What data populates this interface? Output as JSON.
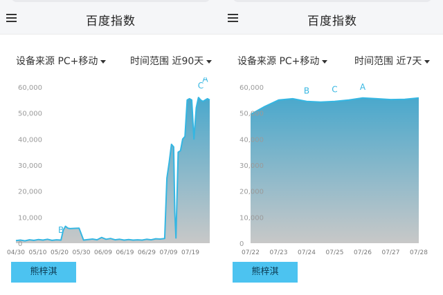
{
  "panels": [
    {
      "title": "百度指数",
      "device_filter": "设备来源 PC+移动",
      "range_filter": "时间范围 近90天",
      "button_label": "熊梓淇",
      "chart_data": {
        "type": "area",
        "title": "",
        "x_tick_labels": [
          "04/30",
          "05/10",
          "05/20",
          "05/30",
          "06/09",
          "06/19",
          "06/29",
          "07/09",
          "07/19"
        ],
        "y_tick_labels": [
          "0",
          "10,000",
          "20,000",
          "30,000",
          "40,000",
          "50,000",
          "60,000"
        ],
        "ylim": [
          0,
          60000
        ],
        "xlim": [
          0,
          86
        ],
        "grid": false,
        "colors": {
          "line": "#35b6e2",
          "fill_top": "#4aa8cc",
          "fill_bottom": "#c8c8c8"
        },
        "x": [
          0,
          2,
          4,
          6,
          8,
          10,
          12,
          14,
          16,
          18,
          20,
          21,
          22,
          23,
          24,
          26,
          28,
          30,
          32,
          34,
          36,
          38,
          40,
          42,
          44,
          46,
          48,
          50,
          52,
          54,
          56,
          58,
          60,
          62,
          64,
          66,
          67,
          68,
          69,
          70,
          70.5,
          71,
          72,
          73,
          74,
          75,
          76,
          77,
          78,
          79,
          80,
          81,
          82,
          83,
          84,
          85,
          86
        ],
        "values": [
          1000,
          1200,
          900,
          1300,
          1100,
          1400,
          1200,
          1500,
          1100,
          1300,
          1200,
          5000,
          6500,
          5800,
          5600,
          5700,
          5800,
          1200,
          1400,
          1600,
          1300,
          2200,
          1500,
          1800,
          1300,
          1500,
          1200,
          1400,
          1200,
          1300,
          1200,
          1500,
          1300,
          1700,
          1600,
          1800,
          25000,
          31000,
          38000,
          37000,
          12000,
          2000,
          35000,
          35500,
          40000,
          41000,
          55000,
          55500,
          55000,
          40000,
          52000,
          56000,
          55000,
          54500,
          55000,
          55500,
          55000
        ],
        "annotations": [
          {
            "label": "B",
            "x": 20,
            "value": 4000
          },
          {
            "label": "C",
            "x": 82,
            "value": 59500
          },
          {
            "label": "A",
            "x": 84,
            "value": 62000
          }
        ]
      }
    },
    {
      "title": "百度指数",
      "device_filter": "设备来源 PC+移动",
      "range_filter": "时间范围 近7天",
      "button_label": "熊梓淇",
      "chart_data": {
        "type": "area",
        "title": "",
        "x_tick_labels": [
          "07/22",
          "07/23",
          "07/24",
          "07/25",
          "07/26",
          "07/27",
          "07/28"
        ],
        "y_tick_labels": [
          "0",
          "10,000",
          "20,000",
          "30,000",
          "40,000",
          "50,000",
          "60,000"
        ],
        "ylim": [
          0,
          60000
        ],
        "xlim": [
          0,
          6
        ],
        "grid": false,
        "colors": {
          "line": "#35b6e2",
          "fill_top": "#4aa8cc",
          "fill_bottom": "#c8c8c8"
        },
        "x": [
          0,
          0.5,
          1,
          1.5,
          2,
          2.5,
          3,
          3.5,
          4,
          4.5,
          5,
          5.5,
          6
        ],
        "values": [
          49500,
          52500,
          55000,
          55500,
          54500,
          54200,
          54500,
          55000,
          55800,
          55500,
          55200,
          55300,
          55800
        ],
        "annotations": [
          {
            "label": "B",
            "x": 2,
            "value": 57500
          },
          {
            "label": "C",
            "x": 3,
            "value": 58000
          },
          {
            "label": "A",
            "x": 4,
            "value": 59000
          }
        ]
      }
    }
  ]
}
